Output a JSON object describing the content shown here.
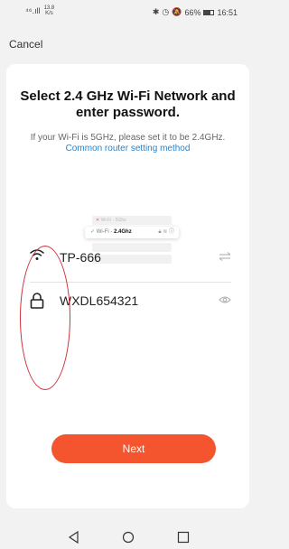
{
  "status_bar": {
    "signal": "⁴⁶.ıll",
    "net_speed": "13.8",
    "net_speed_unit": "K/s",
    "battery_percent": "66%",
    "time": "16:51"
  },
  "header": {
    "cancel_label": "Cancel"
  },
  "card": {
    "title": "Select 2.4 GHz Wi-Fi Network and enter password.",
    "subtitle_text": "If your Wi-Fi is 5GHz, please set it to be 2.4GHz.",
    "subtitle_link": "Common router setting method"
  },
  "illustration": {
    "row1_label": "Wi-Fi - 5Ghz",
    "selected_prefix": "Wi-Fi - ",
    "selected_band": "2.4Ghz"
  },
  "wifi": {
    "network_name": "TP-666"
  },
  "password": {
    "value": "WXDL654321"
  },
  "actions": {
    "next_label": "Next"
  },
  "colors": {
    "accent": "#f4552f",
    "link": "#2f82c4",
    "annotation": "#d0313b"
  },
  "icons": [
    "wifi-icon",
    "swap-icon",
    "lock-icon",
    "eye-icon",
    "nav-back-icon",
    "nav-home-icon",
    "nav-recent-icon"
  ]
}
